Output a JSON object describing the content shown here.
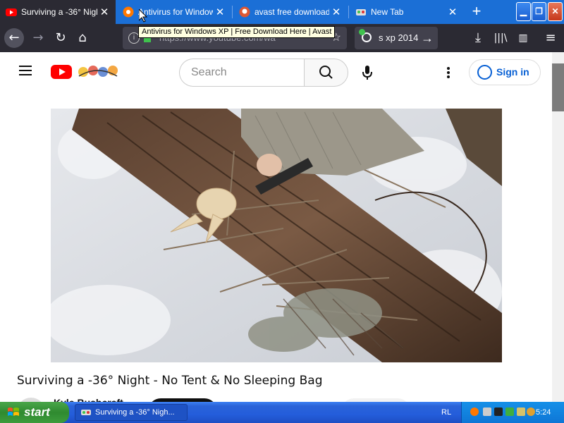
{
  "browser": {
    "tabs": [
      {
        "title": "Surviving a -36° Night",
        "active": true
      },
      {
        "title": "Antivirus for Windows",
        "active": false
      },
      {
        "title": "avast free download",
        "active": false
      },
      {
        "title": "New Tab",
        "active": false
      }
    ],
    "new_tab_label": "+",
    "url": "https://www.youtube.com/wa",
    "search_text": "s xp 2014",
    "tooltip": "Antivirus for Windows XP | Free Download Here | Avast"
  },
  "youtube": {
    "search_placeholder": "Search",
    "signin_label": "Sign in",
    "video_title": "Surviving a -36° Night - No Tent & No Sleeping Bag",
    "channel_name": "Kyle Bushcraft"
  },
  "taskbar": {
    "start_label": "start",
    "task_item": "Surviving a -36° Nigh...",
    "language": "RL",
    "clock": "5:24"
  },
  "colors": {
    "xp_blue": "#245ddb",
    "start_green": "#3d9c3c",
    "youtube_red": "#ff0000",
    "signin_blue": "#065fd4",
    "browser_dark": "#2b2a33"
  }
}
